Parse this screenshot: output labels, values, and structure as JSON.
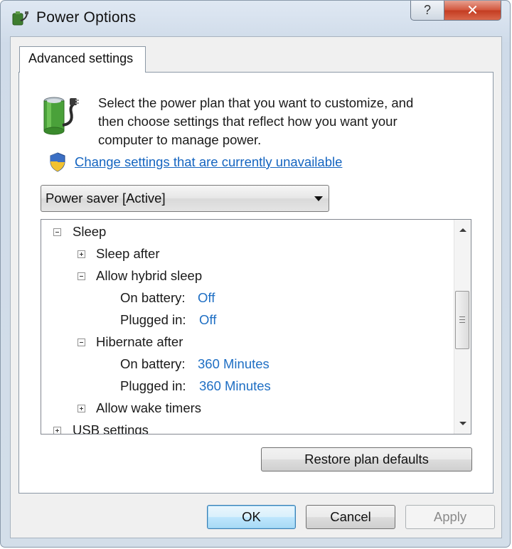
{
  "window": {
    "title": "Power Options",
    "help_glyph": "?",
    "close_glyph": "✕"
  },
  "tabs": [
    {
      "label": "Advanced settings",
      "selected": true
    }
  ],
  "panel": {
    "description_lines": [
      "Select the power plan that you want to customize, and",
      "then choose settings that reflect how you want your",
      "computer to manage power."
    ],
    "change_link": "Change settings that are currently unavailable",
    "plan_dropdown": {
      "selected": "Power saver [Active]"
    },
    "tree": {
      "sleep": {
        "label": "Sleep",
        "expanded": true
      },
      "sleep_after": {
        "label": "Sleep after",
        "expanded": false
      },
      "allow_hybrid_sleep": {
        "label": "Allow hybrid sleep",
        "expanded": true,
        "on_battery": {
          "label": "On battery:",
          "value": "Off"
        },
        "plugged_in": {
          "label": "Plugged in:",
          "value": "Off"
        }
      },
      "hibernate_after": {
        "label": "Hibernate after",
        "expanded": true,
        "on_battery": {
          "label": "On battery:",
          "value": "360 Minutes"
        },
        "plugged_in": {
          "label": "Plugged in:",
          "value": "360 Minutes"
        }
      },
      "allow_wake_timers": {
        "label": "Allow wake timers",
        "expanded": false
      },
      "usb_settings": {
        "label": "USB settings",
        "expanded": false
      }
    },
    "restore_button": "Restore plan defaults"
  },
  "footer": {
    "ok": "OK",
    "cancel": "Cancel",
    "apply": "Apply"
  },
  "colors": {
    "link": "#1565c0",
    "value": "#1f6fc4",
    "close_button": "#c33b21"
  },
  "icons": {
    "app": "power-options-icon",
    "battery": "battery-plug-icon",
    "shield": "uac-shield-icon"
  }
}
